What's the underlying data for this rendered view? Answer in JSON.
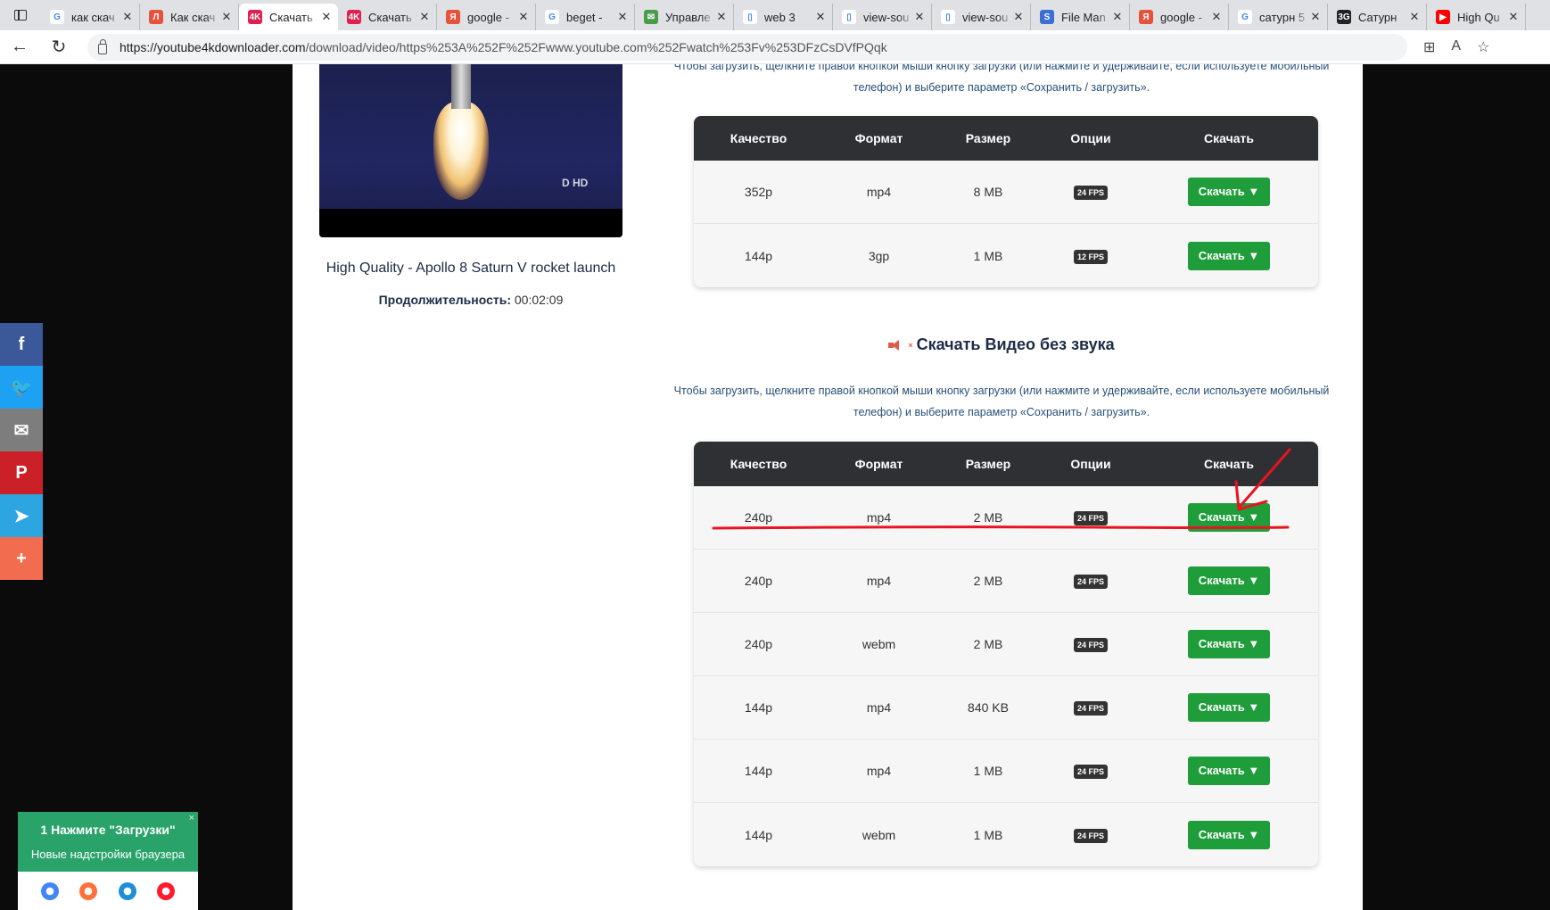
{
  "browser": {
    "tabs": [
      {
        "title": "как скач",
        "favicon": "google-icon",
        "color": "#ffffff",
        "glyph": "G"
      },
      {
        "title": "Как скач",
        "favicon": "yandex-icon",
        "color": "#e5533d",
        "glyph": "Л"
      },
      {
        "title": "Скачать",
        "favicon": "4k-icon",
        "color": "#e0214e",
        "glyph": "4K",
        "active": true
      },
      {
        "title": "Скачать",
        "favicon": "4k-icon",
        "color": "#e0214e",
        "glyph": "4K"
      },
      {
        "title": "google -",
        "favicon": "yandex-icon",
        "color": "#e5533d",
        "glyph": "Я"
      },
      {
        "title": "beget -",
        "favicon": "google-icon",
        "color": "#ffffff",
        "glyph": "G"
      },
      {
        "title": "Управле",
        "favicon": "mail-icon",
        "color": "#4a9b4a",
        "glyph": "✉"
      },
      {
        "title": "web 3",
        "favicon": "page-icon",
        "color": "#ffffff",
        "glyph": "▯"
      },
      {
        "title": "view-sou",
        "favicon": "page-icon",
        "color": "#ffffff",
        "glyph": "▯"
      },
      {
        "title": "view-sou",
        "favicon": "page-icon",
        "color": "#ffffff",
        "glyph": "▯"
      },
      {
        "title": "File Man",
        "favicon": "file-manager-icon",
        "color": "#3b6fd6",
        "glyph": "S"
      },
      {
        "title": "google -",
        "favicon": "yandex-icon",
        "color": "#e5533d",
        "glyph": "Я"
      },
      {
        "title": "сатурн 5",
        "favicon": "google-icon",
        "color": "#ffffff",
        "glyph": "G"
      },
      {
        "title": "Сатурн",
        "favicon": "site-icon",
        "color": "#222222",
        "glyph": "3G"
      },
      {
        "title": "High Qu",
        "favicon": "youtube-icon",
        "color": "#ff0000",
        "glyph": "▶"
      }
    ],
    "url_host": "https://youtube4kdownloader.com",
    "url_path": "/download/video/https%253A%252F%252Fwww.youtube.com%252Fwatch%253Fv%253DFzCsDVfPQqk"
  },
  "video": {
    "title": "High Quality - Apollo 8 Saturn V rocket launch",
    "duration_label": "Продолжительность:",
    "duration_value": "00:02:09",
    "channel_logo": "D HD"
  },
  "instructions_text": "Чтобы загрузить, щелкните правой кнопкой мыши кнопку загрузки (или нажмите и удерживайте, если используете мобильный телефон) и выберите параметр «Сохранить / загрузить».",
  "table_headers": {
    "quality": "Качество",
    "format": "Формат",
    "size": "Размер",
    "options": "Опции",
    "download": "Скачать"
  },
  "download_button_label": "Скачать ▼",
  "table_with_audio": [
    {
      "quality": "352p",
      "format": "mp4",
      "size": "8 MB",
      "fps": "24 FPS"
    },
    {
      "quality": "144p",
      "format": "3gp",
      "size": "1 MB",
      "fps": "12 FPS"
    }
  ],
  "no_audio_section_title": "Скачать Видео без звука",
  "table_no_audio": [
    {
      "quality": "240p",
      "format": "mp4",
      "size": "2 MB",
      "fps": "24 FPS"
    },
    {
      "quality": "240p",
      "format": "mp4",
      "size": "2 MB",
      "fps": "24 FPS"
    },
    {
      "quality": "240p",
      "format": "webm",
      "size": "2 MB",
      "fps": "24 FPS"
    },
    {
      "quality": "144p",
      "format": "mp4",
      "size": "840 KB",
      "fps": "24 FPS"
    },
    {
      "quality": "144p",
      "format": "mp4",
      "size": "1 MB",
      "fps": "24 FPS"
    },
    {
      "quality": "144p",
      "format": "webm",
      "size": "1 MB",
      "fps": "24 FPS"
    }
  ],
  "share_bar": [
    {
      "name": "facebook-share-button",
      "icon": "facebook-icon",
      "glyph": "f",
      "color": "#3b5998"
    },
    {
      "name": "twitter-share-button",
      "icon": "twitter-icon",
      "glyph": "🐦",
      "color": "#1da1f2"
    },
    {
      "name": "email-share-button",
      "icon": "email-icon",
      "glyph": "✉",
      "color": "#7d7d7d"
    },
    {
      "name": "pinterest-share-button",
      "icon": "pinterest-icon",
      "glyph": "P",
      "color": "#cb2027"
    },
    {
      "name": "telegram-share-button",
      "icon": "telegram-icon",
      "glyph": "➤",
      "color": "#2ca5e0"
    },
    {
      "name": "more-share-button",
      "icon": "plus-icon",
      "glyph": "+",
      "color": "#f26c4f"
    }
  ],
  "extension_popup": {
    "title": "1 Нажмите \"Загрузки\"",
    "subtitle": "Новые надстройки браузера",
    "close": "×",
    "browsers": [
      {
        "icon": "chrome-icon",
        "color": "#4285f4"
      },
      {
        "icon": "firefox-icon",
        "color": "#ff7139"
      },
      {
        "icon": "edge-icon",
        "color": "#1f8ed6"
      },
      {
        "icon": "opera-icon",
        "color": "#ff1b2d"
      }
    ]
  },
  "colors": {
    "download_button": "#1e9d3a",
    "table_header": "#2e3033",
    "annotation": "#e8141f"
  }
}
